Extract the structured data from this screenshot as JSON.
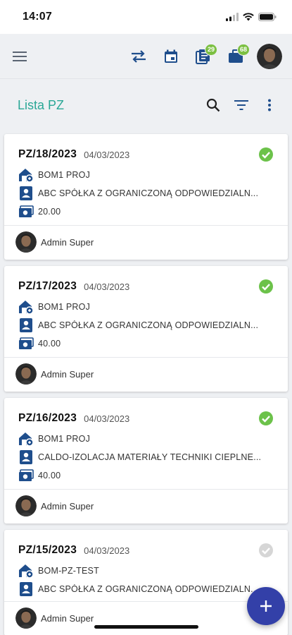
{
  "status_bar": {
    "time": "14:07"
  },
  "header": {
    "badges": {
      "documents": "29",
      "orders": "68"
    }
  },
  "page": {
    "title": "Lista PZ"
  },
  "documents": [
    {
      "number": "PZ/18/2023",
      "date": "04/03/2023",
      "warehouse": "BOM1 PROJ",
      "contractor": "ABC SPÓŁKA Z OGRANICZONĄ ODPOWIEDZIALN...",
      "amount": "20.00",
      "user": "Admin Super",
      "status": "approved"
    },
    {
      "number": "PZ/17/2023",
      "date": "04/03/2023",
      "warehouse": "BOM1 PROJ",
      "contractor": "ABC SPÓŁKA Z OGRANICZONĄ ODPOWIEDZIALN...",
      "amount": "40.00",
      "user": "Admin Super",
      "status": "approved"
    },
    {
      "number": "PZ/16/2023",
      "date": "04/03/2023",
      "warehouse": "BOM1 PROJ",
      "contractor": "CALDO-IZOLACJA MATERIAŁY TECHNIKI CIEPLNE...",
      "amount": "40.00",
      "user": "Admin Super",
      "status": "approved"
    },
    {
      "number": "PZ/15/2023",
      "date": "04/03/2023",
      "warehouse": "BOM-PZ-TEST",
      "contractor": "ABC SPÓŁKA Z OGRANICZONĄ ODPOWIEDZIALN...",
      "amount": "",
      "user": "Admin Super",
      "status": "pending"
    }
  ],
  "colors": {
    "accent": "#2aa796",
    "primary": "#3340a8",
    "icon_blue": "#1f4e8c",
    "approved": "#6cc24a",
    "pending": "#d6d6d6",
    "badge": "#7cc042"
  },
  "icons": [
    "menu-icon",
    "swap-icon",
    "calendar-icon",
    "documents-icon",
    "orders-icon",
    "search-icon",
    "filter-icon",
    "more-vert-icon",
    "warehouse-icon",
    "contractor-icon",
    "money-icon",
    "check-circle-icon",
    "plus-icon"
  ]
}
